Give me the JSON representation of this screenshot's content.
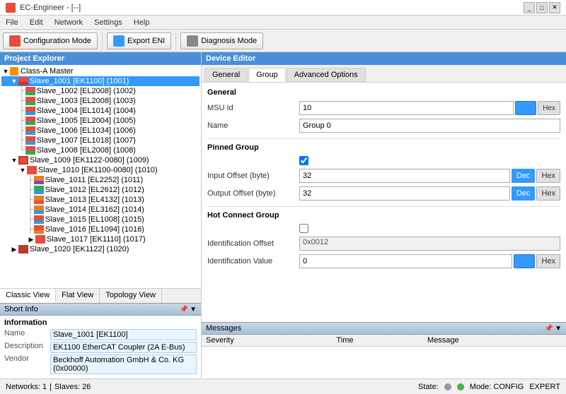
{
  "titleBar": {
    "title": "EC-Engineer - [--]",
    "controls": [
      "minimize",
      "maximize",
      "close"
    ]
  },
  "menuBar": {
    "items": [
      "File",
      "Edit",
      "Network",
      "Settings",
      "Help"
    ]
  },
  "toolbar": {
    "configMode": "Configuration Mode",
    "exportENI": "Export ENI",
    "diagMode": "Diagnosis Mode"
  },
  "projectExplorer": {
    "title": "Project Explorer",
    "tree": [
      {
        "id": 0,
        "label": "Class-A Master",
        "indent": 0,
        "type": "master",
        "expanded": true,
        "selected": false
      },
      {
        "id": 1,
        "label": "Slave_1001 [EK1100] (1001)",
        "indent": 1,
        "type": "coupler",
        "expanded": true,
        "selected": true
      },
      {
        "id": 2,
        "label": "Slave_1002 [EL2008] (1002)",
        "indent": 2,
        "type": "el2008",
        "selected": false
      },
      {
        "id": 3,
        "label": "Slave_1003 [EL2008] (1003)",
        "indent": 2,
        "type": "el2008",
        "selected": false
      },
      {
        "id": 4,
        "label": "Slave_1004 [EL1014] (1004)",
        "indent": 2,
        "type": "el1014",
        "selected": false
      },
      {
        "id": 5,
        "label": "Slave_1005 [EL2004] (1005)",
        "indent": 2,
        "type": "el2004",
        "selected": false
      },
      {
        "id": 6,
        "label": "Slave_1006 [EL1034] (1006)",
        "indent": 2,
        "type": "el1034",
        "selected": false
      },
      {
        "id": 7,
        "label": "Slave_1007 [EL1018] (1007)",
        "indent": 2,
        "type": "el1018",
        "selected": false
      },
      {
        "id": 8,
        "label": "Slave_1008 [EL2008] (1008)",
        "indent": 2,
        "type": "el2008",
        "selected": false
      },
      {
        "id": 9,
        "label": "Slave_1009 [EK1122-0080] (1009)",
        "indent": 1,
        "type": "coupler2",
        "expanded": true,
        "selected": false
      },
      {
        "id": 10,
        "label": "Slave_1010 [EK1100-0080] (1010)",
        "indent": 2,
        "type": "coupler",
        "expanded": true,
        "selected": false
      },
      {
        "id": 11,
        "label": "Slave_1011 [EL2252] (1011)",
        "indent": 3,
        "type": "el2252",
        "selected": false
      },
      {
        "id": 12,
        "label": "Slave_1012 [EL2612] (1012)",
        "indent": 3,
        "type": "el2612",
        "selected": false
      },
      {
        "id": 13,
        "label": "Slave_1013 [EL4132] (1013)",
        "indent": 3,
        "type": "el4132",
        "selected": false
      },
      {
        "id": 14,
        "label": "Slave_1014 [EL3162] (1014)",
        "indent": 3,
        "type": "el3162",
        "selected": false
      },
      {
        "id": 15,
        "label": "Slave_1015 [EL1008] (1015)",
        "indent": 3,
        "type": "el1008",
        "selected": false
      },
      {
        "id": 16,
        "label": "Slave_1016 [EL1094] (1016)",
        "indent": 3,
        "type": "el1094",
        "selected": false
      },
      {
        "id": 17,
        "label": "Slave_1017 [EK1110] (1017)",
        "indent": 3,
        "type": "coupler3",
        "selected": false
      },
      {
        "id": 18,
        "label": "Slave_1020 [EK1122] (1020)",
        "indent": 1,
        "type": "coupler2",
        "expanded": false,
        "selected": false
      }
    ]
  },
  "bottomTabs": [
    "Classic View",
    "Flat View",
    "Topology View"
  ],
  "shortInfo": {
    "title": "Short Info",
    "sectionTitle": "Information",
    "fields": [
      {
        "label": "Name",
        "value": "Slave_1001 [EK1100]"
      },
      {
        "label": "Description",
        "value": "EK1100 EtherCAT Coupler (2A E-Bus)"
      },
      {
        "label": "Vendor",
        "value": "Beckhoff Automation GmbH & Co. KG (0x00000)"
      }
    ]
  },
  "deviceEditor": {
    "title": "Device Editor",
    "tabs": [
      "General",
      "Group",
      "Advanced Options"
    ],
    "activeTab": "Group",
    "general": {
      "msuId": {
        "label": "MSU Id",
        "value": "10"
      },
      "name": {
        "label": "Name",
        "value": "Group 0"
      }
    },
    "pinnedGroup": {
      "title": "Pinned Group",
      "checked": true,
      "inputOffset": {
        "label": "Input Offset (byte)",
        "value": "32"
      },
      "outputOffset": {
        "label": "Output Offset (byte)",
        "value": "32"
      }
    },
    "hotConnectGroup": {
      "title": "Hot Connect Group",
      "checked": false,
      "identificationOffset": {
        "label": "Identification Offset",
        "value": "0x0012"
      },
      "identificationValue": {
        "label": "Identification Value",
        "value": "0"
      }
    },
    "buttons": {
      "dec": "Dec",
      "hex": "Hex"
    }
  },
  "messages": {
    "title": "Messages",
    "columns": [
      "Severity",
      "Time",
      "Message"
    ]
  },
  "statusBar": {
    "networks": "Networks: 1",
    "slaves": "Slaves: 26",
    "state": "State:",
    "mode": "Mode: CONFIG",
    "level": "EXPERT"
  }
}
